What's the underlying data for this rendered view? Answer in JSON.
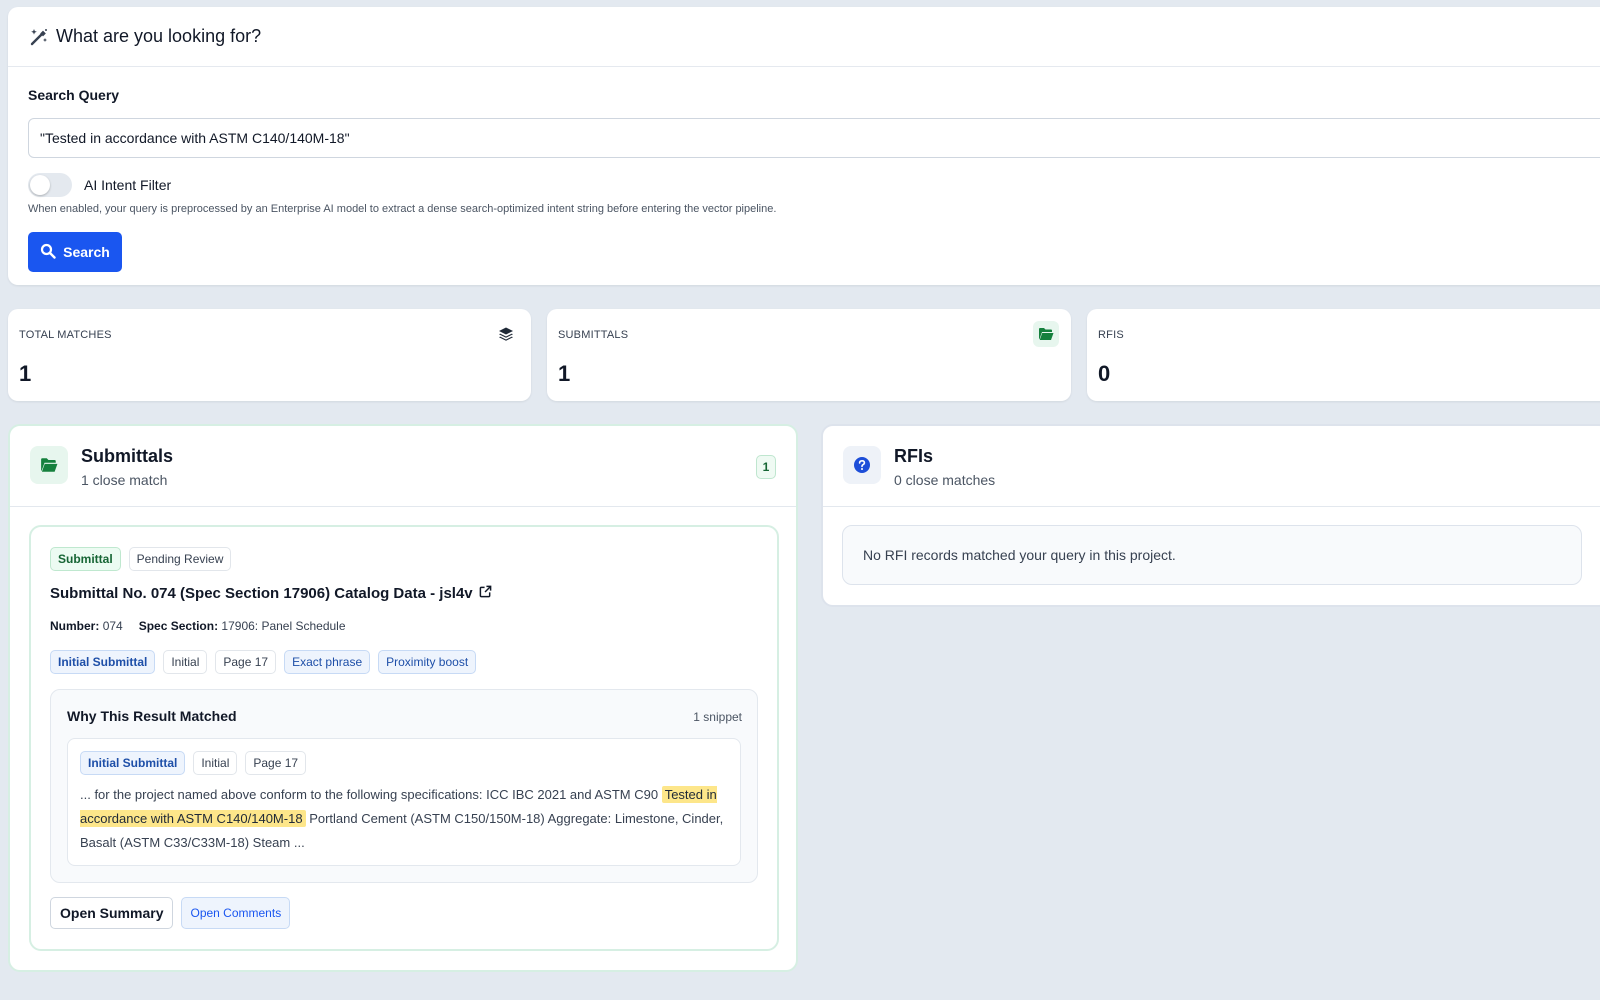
{
  "search": {
    "heading": "What are you looking for?",
    "heading_icon": "magic-wand-icon",
    "query_label": "Search Query",
    "query_value": "\"Tested in accordance with ASTM C140/140M-18\"",
    "ai_filter_label": "AI Intent Filter",
    "ai_filter_enabled": false,
    "ai_filter_help": "When enabled, your query is preprocessed by an Enterprise AI model to extract a dense search-optimized intent string before entering the vector pipeline.",
    "search_button": "Search"
  },
  "stats": [
    {
      "label": "TOTAL MATCHES",
      "value": "1",
      "icon": "layers-icon"
    },
    {
      "label": "SUBMITTALS",
      "value": "1",
      "icon": "folder-open-icon"
    },
    {
      "label": "RFIS",
      "value": "0",
      "icon": ""
    }
  ],
  "submittals_panel": {
    "title": "Submittals",
    "subtitle": "1 close match",
    "count": "1",
    "result": {
      "type_tag": "Submittal",
      "status_tag": "Pending Review",
      "title": "Submittal No. 074 (Spec Section 17906) Catalog Data - jsl4v",
      "number_label": "Number:",
      "number_value": "074",
      "spec_label": "Spec Section:",
      "spec_value": "17906: Panel Schedule",
      "tags": [
        "Initial Submittal",
        "Initial",
        "Page 17",
        "Exact phrase",
        "Proximity boost"
      ],
      "why": {
        "title": "Why This Result Matched",
        "count": "1 snippet",
        "snippet_tags": [
          "Initial Submittal",
          "Initial",
          "Page 17"
        ],
        "text_before": "... for the project named above conform to the following specifications: ICC IBC 2021 and ASTM C90",
        "highlight": "Tested in accordance with ASTM C140/140M-18",
        "text_after": "Portland Cement (ASTM C150/150M-18) Aggregate: Limestone, Cinder, Basalt (ASTM C33/C33M-18) Steam ..."
      },
      "actions": {
        "summary": "Open Summary",
        "comments": "Open Comments"
      }
    }
  },
  "rfis_panel": {
    "title": "RFIs",
    "subtitle": "0 close matches",
    "empty_message": "No RFI records matched your query in this project."
  },
  "colors": {
    "primary": "#1a56f0",
    "success": "#166534",
    "highlight": "#fde68a",
    "background": "#e3e9f0"
  }
}
